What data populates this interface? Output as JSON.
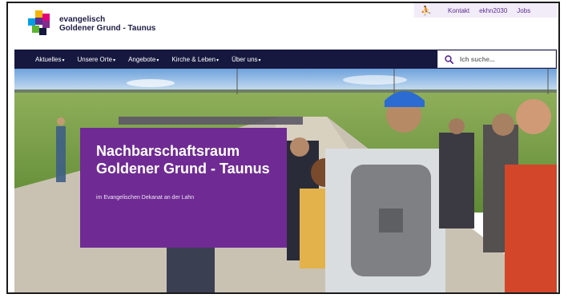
{
  "brand": {
    "line1": "evangelisch",
    "line2": "Goldener Grund - Taunus",
    "logo_colors": [
      "#f6b400",
      "#e2007a",
      "#009fe3",
      "#5bb531",
      "#7f2d8e"
    ]
  },
  "toplinks": {
    "accessibility_icon": "accessibility-icon",
    "items": [
      "Kontakt",
      "ekhn2030",
      "Jobs"
    ]
  },
  "nav": {
    "items": [
      "Aktuelles",
      "Unsere Orte",
      "Angebote",
      "Kirche & Leben",
      "Über uns"
    ],
    "search_placeholder": "Ich suche..."
  },
  "hero": {
    "title": "Nachbarschaftsraum Goldener Grund - Taunus",
    "subtitle": "im Evangelischen Dekanat an der Lahn",
    "card_color": "#6f2b93"
  },
  "colors": {
    "nav_bg": "#16183f",
    "accent": "#5b2d91"
  }
}
